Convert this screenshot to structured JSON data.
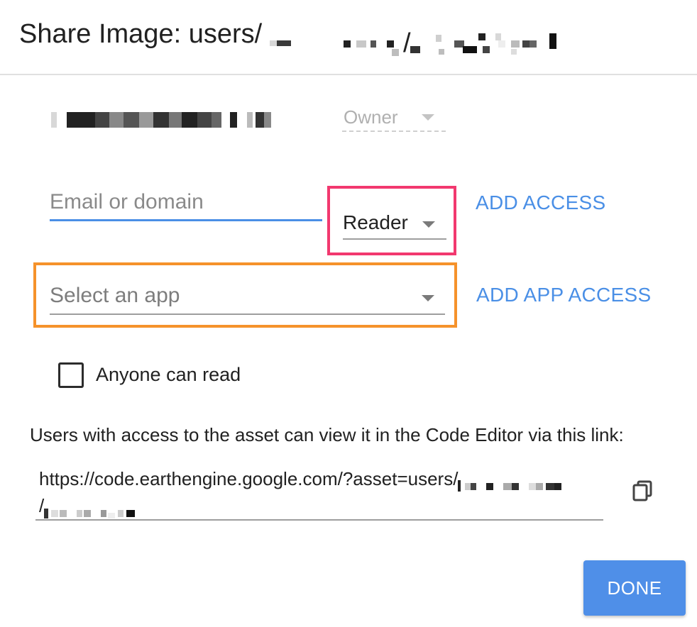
{
  "dialog": {
    "title": "Share Image: users/",
    "title_redacted": "[redacted]"
  },
  "owner": {
    "email_redacted": "[redacted]",
    "role_label": "Owner"
  },
  "add_access": {
    "email_placeholder": "Email or domain",
    "email_value": "",
    "role_selected": "Reader",
    "button_label": "ADD ACCESS"
  },
  "app_access": {
    "placeholder": "Select an app",
    "button_label": "ADD APP ACCESS"
  },
  "anyone_can_read": {
    "label": "Anyone can read",
    "checked": false
  },
  "info_text": "Users with access to the asset can view it in the Code Editor via this link:",
  "link": {
    "line1": "https://code.earthengine.google.com/?asset=users/",
    "line2": "/"
  },
  "icons": {
    "copy": "copy-icon"
  },
  "footer": {
    "done_label": "DONE"
  },
  "colors": {
    "accent_blue": "#4a8fe6",
    "highlight_pink": "#f2386f",
    "highlight_orange": "#f5922b",
    "done_button": "#4f8fe8"
  }
}
